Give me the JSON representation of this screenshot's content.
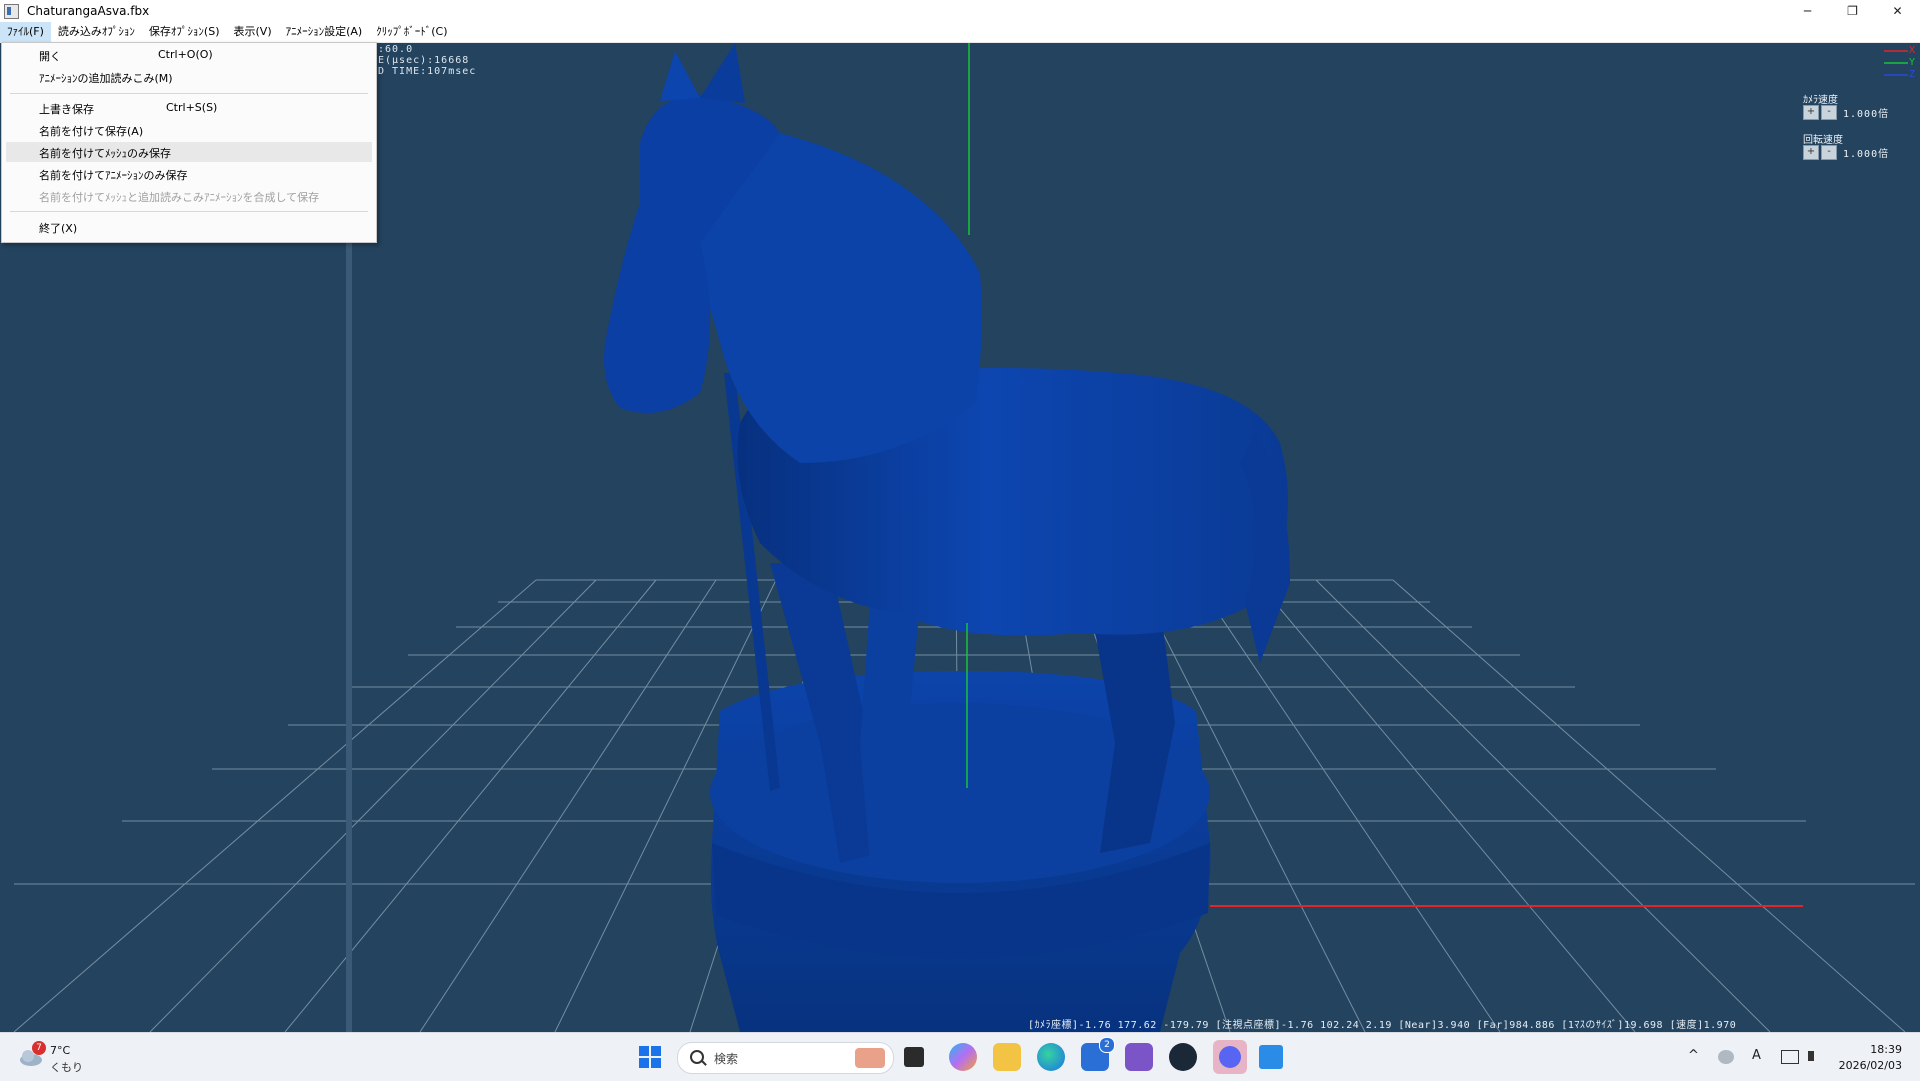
{
  "window": {
    "title": "ChaturangaAsva.fbx",
    "controls": {
      "minimize": "─",
      "restore": "❐",
      "close": "✕"
    }
  },
  "menubar": [
    "ﾌｧｲﾙ(F)",
    "読み込みｵﾌﾟｼｮﾝ",
    "保存ｵﾌﾟｼｮﾝ(S)",
    "表示(V)",
    "ｱﾆﾒｰｼｮﾝ設定(A)",
    "ｸﾘｯﾌﾟﾎﾞｰﾄﾞ(C)"
  ],
  "file_menu": {
    "items": [
      {
        "label": "開く",
        "shortcut": "Ctrl+O(O)"
      },
      {
        "label": "ｱﾆﾒｰｼｮﾝの追加読みこみ(M)",
        "shortcut": ""
      },
      {
        "label": "上書き保存",
        "shortcut": "Ctrl+S(S)"
      },
      {
        "label": "名前を付けて保存(A)",
        "shortcut": ""
      },
      {
        "label": "名前を付けてﾒｯｼｭのみ保存",
        "shortcut": ""
      },
      {
        "label": "名前を付けてｱﾆﾒｰｼｮﾝのみ保存",
        "shortcut": ""
      },
      {
        "label": "名前を付けてﾒｯｼｭと追加読みこみｱﾆﾒｰｼｮﾝを合成して保存",
        "shortcut": ""
      },
      {
        "label": "終了(X)",
        "shortcut": ""
      }
    ]
  },
  "hud": {
    "line1": ":60.0",
    "line2": "E(μsec):16668",
    "line3": "D TIME:107msec"
  },
  "speed_panel": {
    "camera_label": "ｶﾒﾗ速度",
    "camera_value": "1.000倍",
    "rotation_label": "回転速度",
    "rotation_value": "1.000倍",
    "plus": "+",
    "minus": "-"
  },
  "axis_legend": [
    "X",
    "Y",
    "Z"
  ],
  "status_line": "[ｶﾒﾗ座標]-1.76 177.62 -179.79 [注視点座標]-1.76 102.24 2.19 [Near]3.940 [Far]984.886 [1ﾏｽのｻｲｽﾞ]19.698 [速度]1.970",
  "taskbar": {
    "weather_temp": "7°C",
    "weather_desc": "くもり",
    "weather_badge": "7",
    "search_placeholder": "検索",
    "store_badge": "2",
    "clock_time": "18:39",
    "clock_date": "2026/02/03",
    "ime_indicator": "A",
    "tray_chevron": "^"
  },
  "colors": {
    "viewport_bg": "#23435f",
    "model": "#0a3b9a",
    "grid": "#8fa6b8",
    "axis_x": "#e0262b",
    "axis_y": "#19c13a",
    "axis_z": "#2a4bd7"
  }
}
